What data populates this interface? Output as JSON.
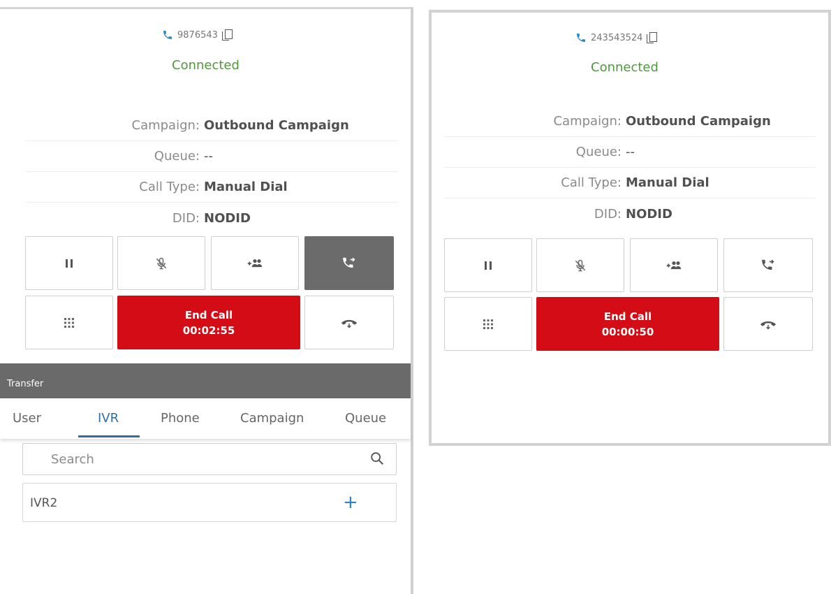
{
  "left_call": {
    "phone_number": "9876543",
    "status": "Connected",
    "details": [
      {
        "label": "Campaign:",
        "value": "Outbound Campaign"
      },
      {
        "label": "Queue:",
        "value": "--"
      },
      {
        "label": "Call Type:",
        "value": "Manual Dial"
      },
      {
        "label": "DID:",
        "value": "NODID"
      }
    ],
    "end_call": {
      "label": "End Call",
      "timer": "00:02:55"
    },
    "transfer_active": true
  },
  "right_call": {
    "phone_number": "243543524",
    "status": "Connected",
    "details": [
      {
        "label": "Campaign:",
        "value": "Outbound Campaign"
      },
      {
        "label": "Queue:",
        "value": "--"
      },
      {
        "label": "Call Type:",
        "value": "Manual Dial"
      },
      {
        "label": "DID:",
        "value": "NODID"
      }
    ],
    "end_call": {
      "label": "End Call",
      "timer": "00:00:50"
    },
    "transfer_active": false
  },
  "transfer_panel": {
    "title": "Transfer",
    "tabs": [
      "User",
      "IVR",
      "Phone",
      "Campaign",
      "Queue"
    ],
    "active_tab": "IVR",
    "search_placeholder": "Search",
    "results": [
      {
        "label": "IVR2"
      }
    ]
  },
  "icons": {
    "phone": "phone-icon",
    "copy": "copy-icon",
    "hold": "pause-icon",
    "mute": "mic-off-icon",
    "conference": "add-participant-icon",
    "transfer": "call-transfer-icon",
    "dialpad": "dialpad-icon",
    "disposition": "hangup-icon",
    "search": "search-icon",
    "add": "plus-icon"
  },
  "colors": {
    "connected": "#4e9a3a",
    "end_call": "#d40c16",
    "accent": "#2f6ea4",
    "active_button": "#6b6b6b",
    "transfer_bar": "#6a6a6a"
  }
}
